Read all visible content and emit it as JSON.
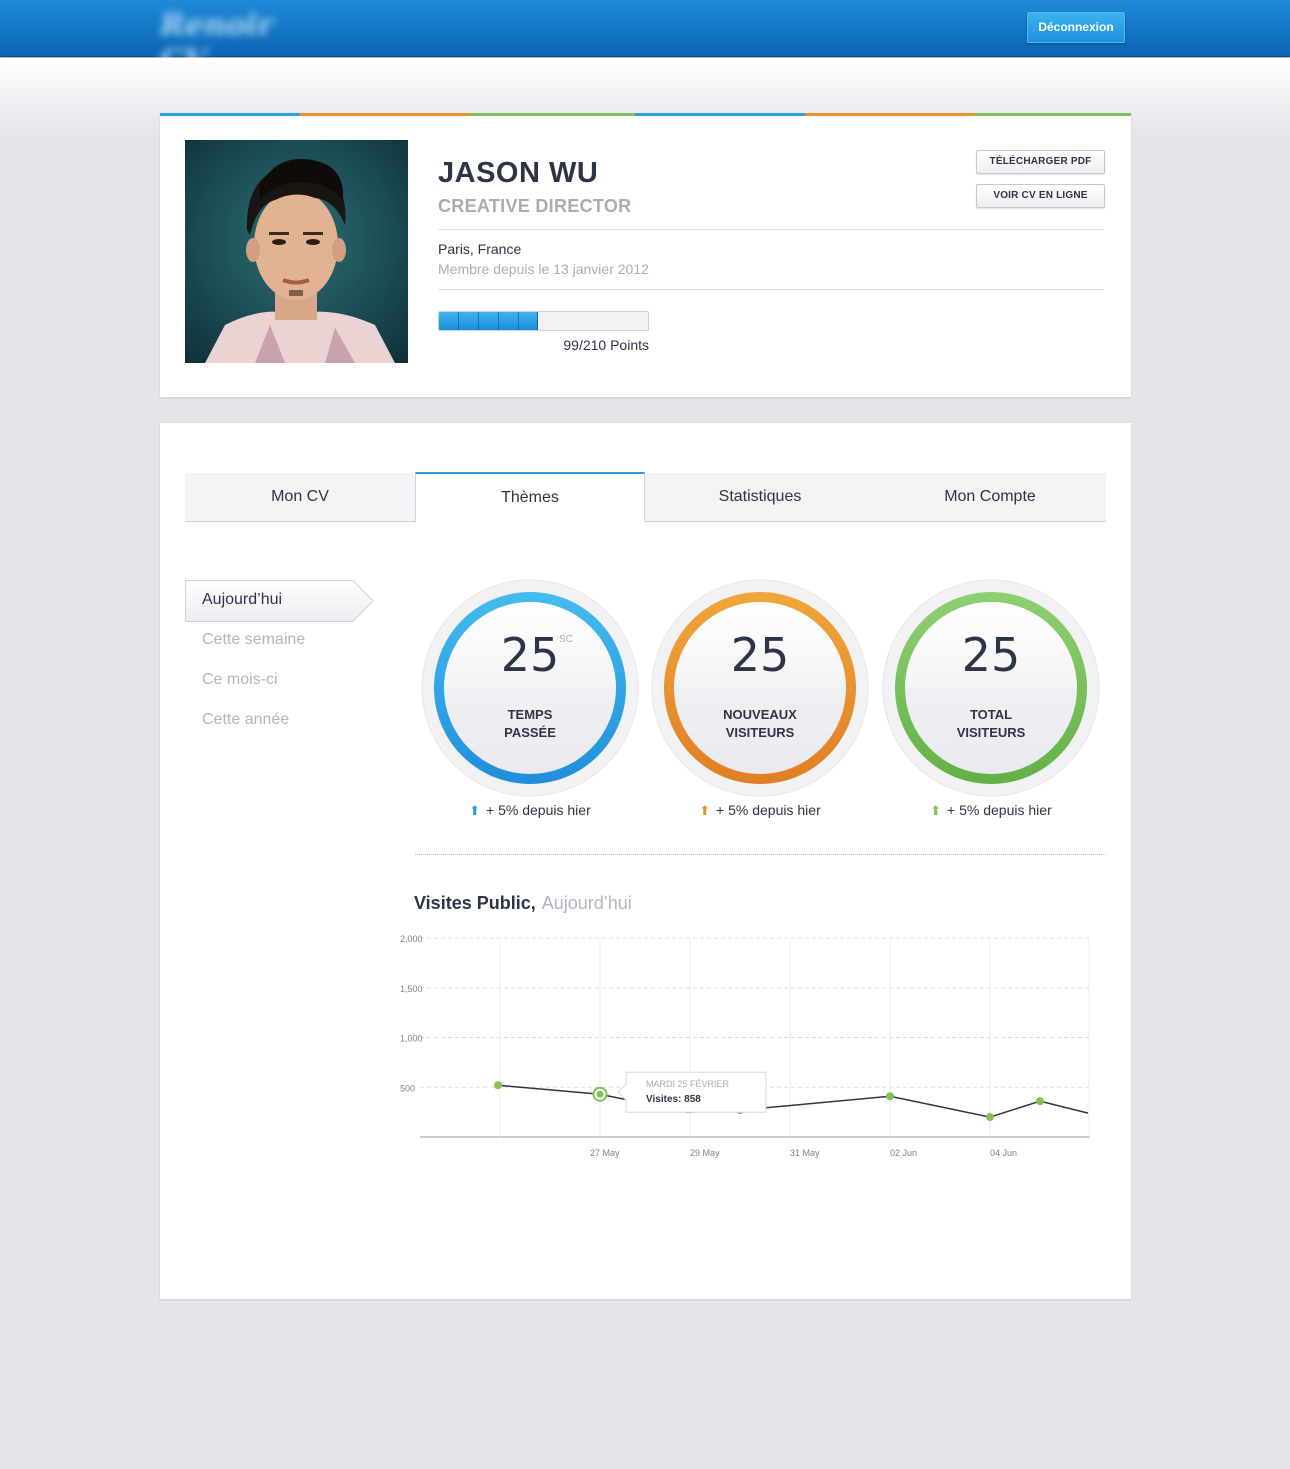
{
  "header": {
    "logo_text": "Renoir CV",
    "logout_label": "Déconnexion"
  },
  "profile": {
    "name": "JASON WU",
    "title": "CREATIVE DIRECTOR",
    "location": "Paris, France",
    "member_since": "Membre depuis le 13 janvier 2012",
    "points_text": "99/210 Points",
    "points_value": 99,
    "points_max": 210,
    "download_pdf_label": "TÉLÉCHARGER PDF",
    "view_online_label": "VOIR CV EN LIGNE"
  },
  "accent_colors": {
    "blue": "#2b9ee0",
    "orange": "#e8912e",
    "green": "#7cc35a"
  },
  "tabs": [
    {
      "label": "Mon CV",
      "active": false
    },
    {
      "label": "Thèmes",
      "active": true
    },
    {
      "label": "Statistiques",
      "active": false
    },
    {
      "label": "Mon Compte",
      "active": false
    }
  ],
  "periods": [
    {
      "label": "Aujourd’hui",
      "active": true
    },
    {
      "label": "Cette semaine",
      "active": false
    },
    {
      "label": "Ce mois-ci",
      "active": false
    },
    {
      "label": "Cette année",
      "active": false
    }
  ],
  "stats": [
    {
      "value": "25",
      "unit": "SC",
      "label_line1": "TEMPS",
      "label_line2": "PASSÉE",
      "delta": "+ 5% depuis hier",
      "color": "#2b9ee0",
      "icon": "arrow-up-icon"
    },
    {
      "value": "25",
      "unit": "",
      "label_line1": "NOUVEAUX",
      "label_line2": "VISITEURS",
      "delta": "+ 5% depuis hier",
      "color": "#e8912e",
      "icon": "arrow-up-icon"
    },
    {
      "value": "25",
      "unit": "",
      "label_line1": "TOTAL",
      "label_line2": "VISITEURS",
      "delta": "+ 5% depuis hier",
      "color": "#7cc35a",
      "icon": "arrow-up-icon"
    }
  ],
  "chart_section": {
    "title": "Visites Public,",
    "period": "Aujourd’hui"
  },
  "chart_data": {
    "type": "line",
    "y_ticks": [
      "2,000",
      "1,500",
      "1,000",
      "500"
    ],
    "ylim": [
      0,
      2000
    ],
    "x_tick_labels": [
      "27 May",
      "29 May",
      "31 May",
      "02 Jun",
      "04 Jun"
    ],
    "grid": true,
    "series": [
      {
        "values": [
          520,
          430,
          250,
          270,
          410,
          200,
          360,
          240
        ],
        "markers": [
          true,
          true,
          false,
          true,
          true,
          true,
          true,
          false
        ]
      }
    ],
    "tooltip": {
      "date": "MARDI 25 FÉVRIER",
      "value_text": "Visites: 858",
      "point_index": 1
    }
  }
}
